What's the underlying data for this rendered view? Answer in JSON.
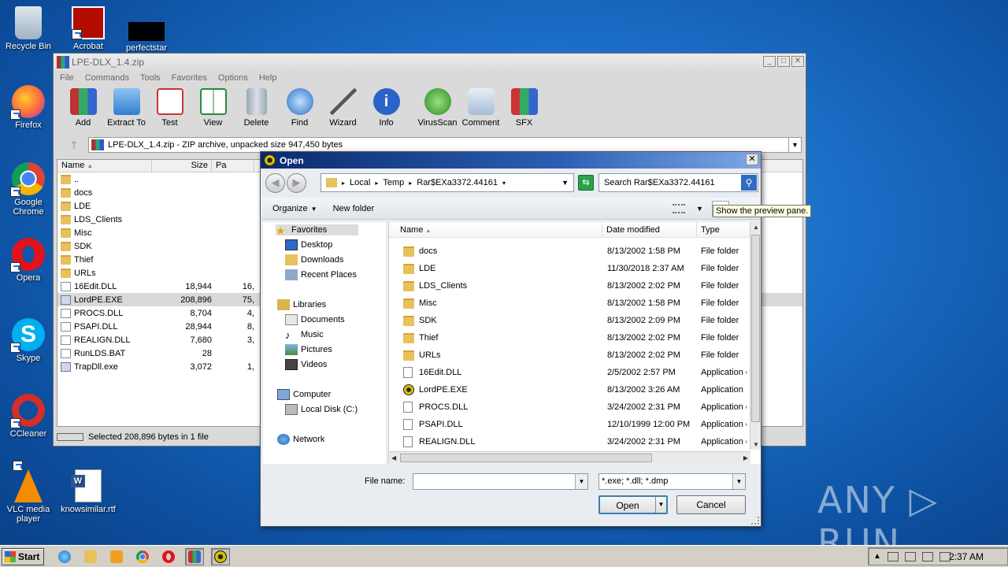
{
  "desktop": {
    "icons": [
      {
        "label": "Recycle Bin"
      },
      {
        "label": "Acrobat"
      },
      {
        "label": "perfectstar"
      },
      {
        "label": "Firefox"
      },
      {
        "label": "Google Chrome"
      },
      {
        "label": "Opera"
      },
      {
        "label": "Skype"
      },
      {
        "label": "CCleaner"
      },
      {
        "label": "VLC media player"
      },
      {
        "label": "knowsimilar.rtf"
      }
    ],
    "watermark": "ANY ▷ RUN"
  },
  "winrar": {
    "title": "LPE-DLX_1.4.zip",
    "menu": [
      "File",
      "Commands",
      "Tools",
      "Favorites",
      "Options",
      "Help"
    ],
    "toolbar": [
      "Add",
      "Extract To",
      "Test",
      "View",
      "Delete",
      "Find",
      "Wizard",
      "Info",
      "VirusScan",
      "Comment",
      "SFX"
    ],
    "path": "LPE-DLX_1.4.zip - ZIP archive, unpacked size 947,450 bytes",
    "columns": {
      "name": "Name",
      "size": "Size",
      "packed": "Pa"
    },
    "files": [
      {
        "name": "..",
        "size": "",
        "packed": ""
      },
      {
        "name": "docs",
        "size": "",
        "packed": ""
      },
      {
        "name": "LDE",
        "size": "",
        "packed": ""
      },
      {
        "name": "LDS_Clients",
        "size": "",
        "packed": ""
      },
      {
        "name": "Misc",
        "size": "",
        "packed": ""
      },
      {
        "name": "SDK",
        "size": "",
        "packed": ""
      },
      {
        "name": "Thief",
        "size": "",
        "packed": ""
      },
      {
        "name": "URLs",
        "size": "",
        "packed": ""
      },
      {
        "name": "16Edit.DLL",
        "size": "18,944",
        "packed": "16,"
      },
      {
        "name": "LordPE.EXE",
        "size": "208,896",
        "packed": "75,"
      },
      {
        "name": "PROCS.DLL",
        "size": "8,704",
        "packed": "4,"
      },
      {
        "name": "PSAPI.DLL",
        "size": "28,944",
        "packed": "8,"
      },
      {
        "name": "REALIGN.DLL",
        "size": "7,680",
        "packed": "3,"
      },
      {
        "name": "RunLDS.BAT",
        "size": "28",
        "packed": ""
      },
      {
        "name": "TrapDll.exe",
        "size": "3,072",
        "packed": "1,"
      }
    ],
    "status": "Selected 208,896 bytes in 1 file"
  },
  "dialog": {
    "title": "Open",
    "breadcrumbs": [
      "Local",
      "Temp",
      "Rar$EXa3372.44161"
    ],
    "search_placeholder": "Search Rar$EXa3372.44161",
    "organize": "Organize",
    "new_folder": "New folder",
    "tooltip": "Show the preview pane.",
    "nav": {
      "favorites": "Favorites",
      "desktop": "Desktop",
      "downloads": "Downloads",
      "recent": "Recent Places",
      "libraries": "Libraries",
      "documents": "Documents",
      "music": "Music",
      "pictures": "Pictures",
      "videos": "Videos",
      "computer": "Computer",
      "local_disk": "Local Disk (C:)",
      "network": "Network"
    },
    "columns": {
      "name": "Name",
      "date": "Date modified",
      "type": "Type"
    },
    "files": [
      {
        "name": "docs",
        "date": "8/13/2002 1:58 PM",
        "type": "File folder",
        "kind": "folder"
      },
      {
        "name": "LDE",
        "date": "11/30/2018 2:37 AM",
        "type": "File folder",
        "kind": "folder"
      },
      {
        "name": "LDS_Clients",
        "date": "8/13/2002 2:02 PM",
        "type": "File folder",
        "kind": "folder"
      },
      {
        "name": "Misc",
        "date": "8/13/2002 1:58 PM",
        "type": "File folder",
        "kind": "folder"
      },
      {
        "name": "SDK",
        "date": "8/13/2002 2:09 PM",
        "type": "File folder",
        "kind": "folder"
      },
      {
        "name": "Thief",
        "date": "8/13/2002 2:02 PM",
        "type": "File folder",
        "kind": "folder"
      },
      {
        "name": "URLs",
        "date": "8/13/2002 2:02 PM",
        "type": "File folder",
        "kind": "folder"
      },
      {
        "name": "16Edit.DLL",
        "date": "2/5/2002 2:57 PM",
        "type": "Application e",
        "kind": "dll"
      },
      {
        "name": "LordPE.EXE",
        "date": "8/13/2002 3:26 AM",
        "type": "Application",
        "kind": "exe"
      },
      {
        "name": "PROCS.DLL",
        "date": "3/24/2002 2:31 PM",
        "type": "Application e",
        "kind": "dll"
      },
      {
        "name": "PSAPI.DLL",
        "date": "12/10/1999 12:00 PM",
        "type": "Application e",
        "kind": "dll"
      },
      {
        "name": "REALIGN.DLL",
        "date": "3/24/2002 2:31 PM",
        "type": "Application e",
        "kind": "dll"
      }
    ],
    "filename_label": "File name:",
    "filename_value": "",
    "filetype": "*.exe; *.dll; *.dmp",
    "open_label": "Open",
    "cancel_label": "Cancel"
  },
  "taskbar": {
    "start": "Start",
    "clock": "2:37 AM"
  }
}
